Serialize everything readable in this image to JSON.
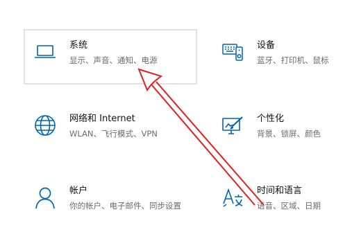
{
  "colors": {
    "accent": "#0063b1",
    "annotation": "#e02020",
    "selected_border": "#e1e1e1"
  },
  "tiles": [
    {
      "icon": "laptop-icon",
      "title": "系统",
      "desc": "显示、声音、通知、电源"
    },
    {
      "icon": "devices-icon",
      "title": "设备",
      "desc": "蓝牙、打印机、鼠标"
    },
    {
      "icon": "globe-icon",
      "title": "网络和 Internet",
      "desc": "WLAN、飞行模式、VPN"
    },
    {
      "icon": "personalization-icon",
      "title": "个性化",
      "desc": "背景、锁屏、颜色"
    },
    {
      "icon": "person-icon",
      "title": "帐户",
      "desc": "你的帐户、电子邮件、同步设置"
    },
    {
      "icon": "time-language-icon",
      "title": "时间和语言",
      "desc": "语音、区域、日期"
    }
  ]
}
